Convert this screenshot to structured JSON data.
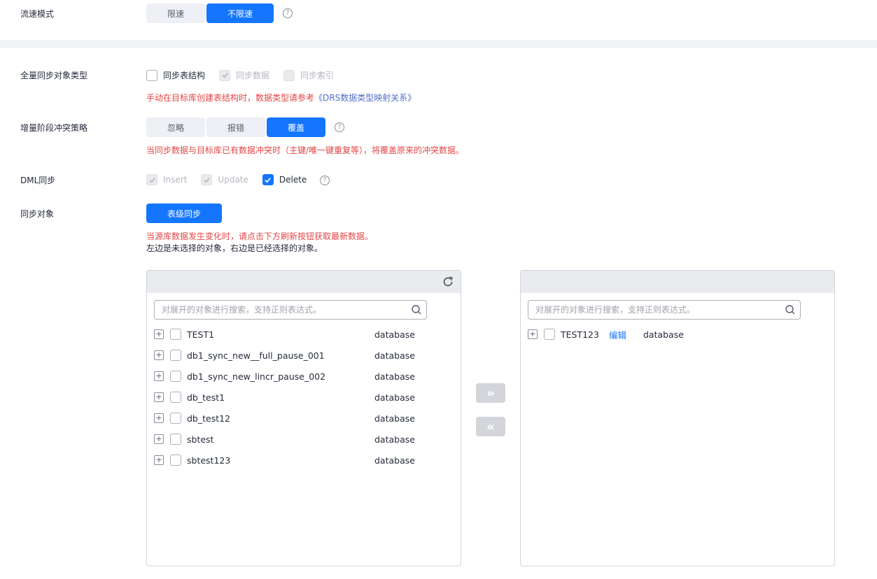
{
  "speed_mode": {
    "label": "流速模式",
    "options": [
      "限速",
      "不限速"
    ],
    "active_index": 1
  },
  "full_sync": {
    "label": "全量同步对象类型",
    "options": [
      {
        "label": "同步表结构",
        "checked": false,
        "disabled": false
      },
      {
        "label": "同步数据",
        "checked": true,
        "disabled": true
      },
      {
        "label": "同步索引",
        "checked": false,
        "disabled": true
      }
    ],
    "note": "手动在目标库创建表结构时，数据类型请参考",
    "note_link": "《DRS数据类型映射关系》"
  },
  "conflict": {
    "label": "增量阶段冲突策略",
    "options": [
      "忽略",
      "报错",
      "覆盖"
    ],
    "active_index": 2,
    "note": "当同步数据与目标库已有数据冲突时（主键/唯一键重复等），将覆盖原来的冲突数据。"
  },
  "dml": {
    "label": "DML同步",
    "options": [
      {
        "label": "Insert",
        "checked": true,
        "disabled": true
      },
      {
        "label": "Update",
        "checked": true,
        "disabled": true
      },
      {
        "label": "Delete",
        "checked": true,
        "disabled": false
      }
    ]
  },
  "sync_objects": {
    "label": "同步对象",
    "button": "表级同步",
    "note_red": "当源库数据发生变化时，请点击下方刷新按钮获取最新数据。",
    "note_black": "左边是未选择的对象，右边是已经选择的对象。"
  },
  "left_panel": {
    "search_placeholder": "对展开的对象进行搜索，支持正则表达式。",
    "items": [
      {
        "name": "TEST1",
        "type": "database"
      },
      {
        "name": "db1_sync_new__full_pause_001",
        "type": "database"
      },
      {
        "name": "db1_sync_new_lincr_pause_002",
        "type": "database"
      },
      {
        "name": "db_test1",
        "type": "database"
      },
      {
        "name": "db_test12",
        "type": "database"
      },
      {
        "name": "sbtest",
        "type": "database"
      },
      {
        "name": "sbtest123",
        "type": "database"
      }
    ]
  },
  "right_panel": {
    "search_placeholder": "对展开的对象进行搜索，支持正则表达式。",
    "items": [
      {
        "name": "TEST123",
        "edit": "编辑",
        "type": "database"
      }
    ]
  },
  "transfer": {
    "add_all": "»",
    "remove_all": "«"
  },
  "glyphs": {
    "help": "?",
    "expand": "+"
  },
  "colors": {
    "primary": "#1476ff",
    "warning_text": "#e54545",
    "link": "#526ecc"
  }
}
